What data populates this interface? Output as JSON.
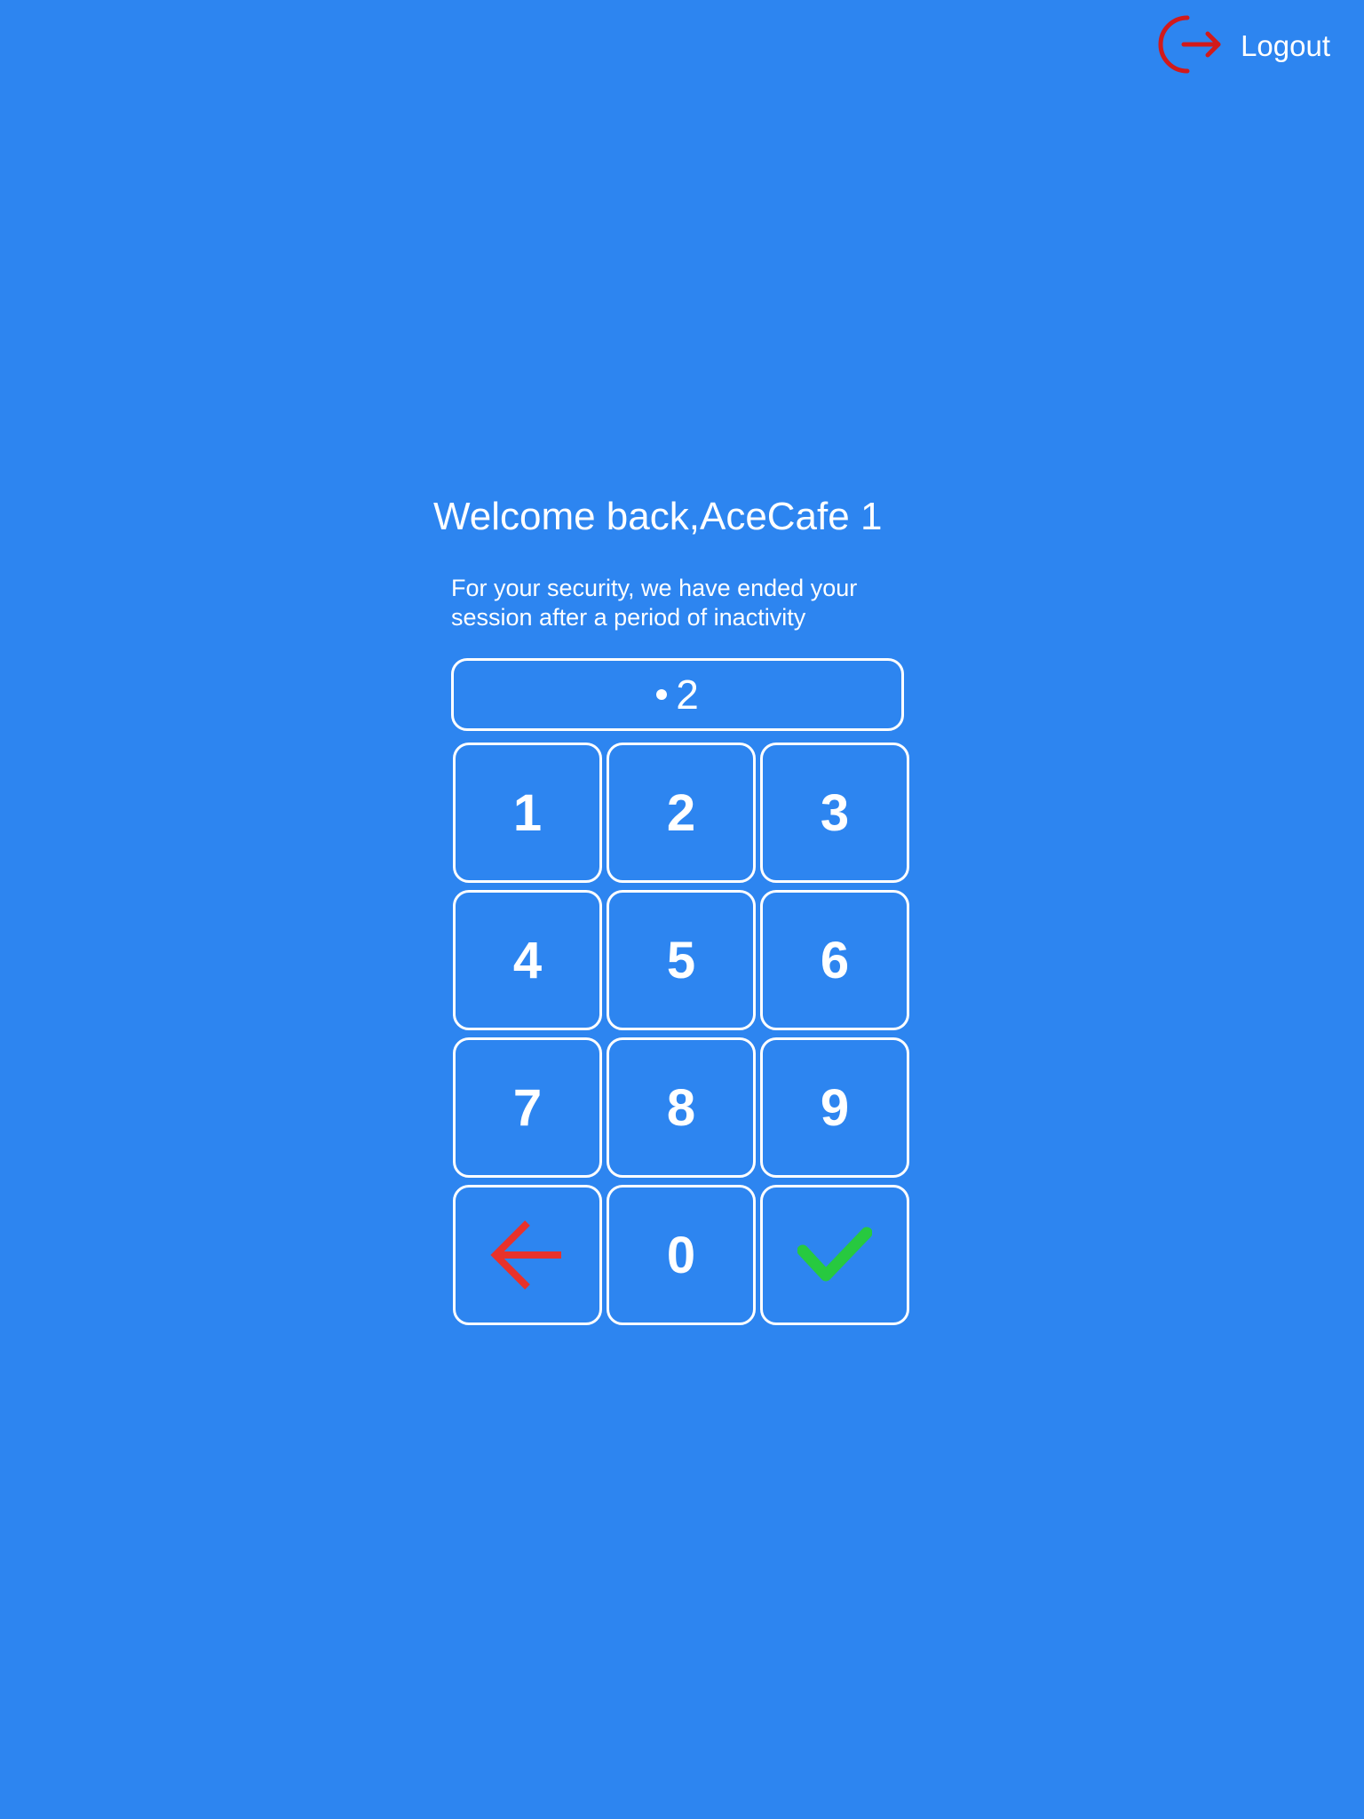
{
  "header": {
    "logout_label": "Logout",
    "logout_icon": "logout-icon",
    "logout_icon_color": "#d21a1a"
  },
  "welcome": {
    "title": "Welcome back,AceCafe 1",
    "message": "For your security, we have ended your session after a period of inactivity"
  },
  "pin": {
    "masked_count": 1,
    "visible_digit": "2"
  },
  "keypad": {
    "keys": [
      "1",
      "2",
      "3",
      "4",
      "5",
      "6",
      "7",
      "8",
      "9",
      "0"
    ],
    "backspace_icon": "arrow-left-icon",
    "backspace_color": "#e8322b",
    "submit_icon": "check-icon",
    "submit_color": "#27c93f"
  },
  "colors": {
    "background": "#2d85f0",
    "foreground": "#ffffff"
  }
}
